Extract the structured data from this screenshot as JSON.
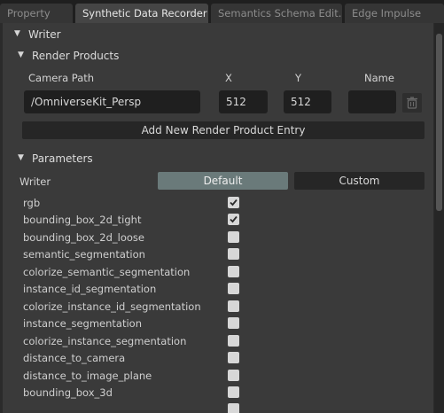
{
  "tabs": [
    {
      "label": "Property",
      "active": false
    },
    {
      "label": "Synthetic Data Recorder",
      "active": true
    },
    {
      "label": "Semantics Schema Edit...",
      "active": false
    },
    {
      "label": "Edge Impulse",
      "active": false
    }
  ],
  "writer_section": {
    "label": "Writer"
  },
  "render_products": {
    "label": "Render Products",
    "columns": {
      "camera_path": "Camera Path",
      "x": "X",
      "y": "Y",
      "name": "Name"
    },
    "entry": {
      "camera_path": "/OmniverseKit_Persp",
      "x": "512",
      "y": "512",
      "name": ""
    },
    "add_button": "Add New Render Product Entry",
    "delete_icon": "trash-icon"
  },
  "parameters": {
    "label": "Parameters",
    "writer_label": "Writer",
    "default_button": "Default",
    "custom_button": "Custom",
    "selected": "Default",
    "items": [
      {
        "name": "rgb",
        "checked": true
      },
      {
        "name": "bounding_box_2d_tight",
        "checked": true
      },
      {
        "name": "bounding_box_2d_loose",
        "checked": false
      },
      {
        "name": "semantic_segmentation",
        "checked": false
      },
      {
        "name": "colorize_semantic_segmentation",
        "checked": false
      },
      {
        "name": "instance_id_segmentation",
        "checked": false
      },
      {
        "name": "colorize_instance_id_segmentation",
        "checked": false
      },
      {
        "name": "instance_segmentation",
        "checked": false
      },
      {
        "name": "colorize_instance_segmentation",
        "checked": false
      },
      {
        "name": "distance_to_camera",
        "checked": false
      },
      {
        "name": "distance_to_image_plane",
        "checked": false
      },
      {
        "name": "bounding_box_3d",
        "checked": false
      }
    ]
  },
  "colors": {
    "panel": "#3a3a3a",
    "field": "#1f1f1f",
    "selected_button": "#6a7a7a"
  }
}
